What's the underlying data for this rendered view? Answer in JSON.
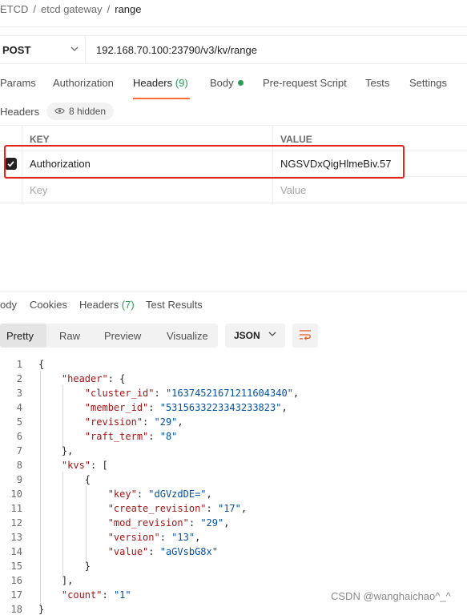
{
  "breadcrumb": {
    "items": [
      "ETCD",
      "etcd gateway",
      "range"
    ],
    "sep": "/"
  },
  "request": {
    "method": "POST",
    "url": "192.168.70.100:23790/v3/kv/range"
  },
  "req_tabs": [
    {
      "label": "Params"
    },
    {
      "label": "Authorization"
    },
    {
      "label": "Headers",
      "count": "(9)"
    },
    {
      "label": "Body"
    },
    {
      "label": "Pre-request Script"
    },
    {
      "label": "Tests"
    },
    {
      "label": "Settings"
    }
  ],
  "headers_section": {
    "label": "Headers",
    "hidden": "8 hidden"
  },
  "table": {
    "col_key": "KEY",
    "col_value": "VALUE",
    "rows": [
      {
        "key": "Authorization",
        "value": "NGSVDxQigHlmeBiv.57",
        "checked": true
      }
    ],
    "placeholder_key": "Key",
    "placeholder_value": "Value"
  },
  "response": {
    "tabs": [
      {
        "label": "ody"
      },
      {
        "label": "Cookies"
      },
      {
        "label": "Headers",
        "count": "(7)"
      },
      {
        "label": "Test Results"
      }
    ],
    "formats": [
      "Pretty",
      "Raw",
      "Preview",
      "Visualize"
    ],
    "language": "JSON",
    "code": [
      {
        "n": "1",
        "t": "{"
      },
      {
        "n": "2",
        "t": "    \"header\": {"
      },
      {
        "n": "3",
        "t": "        \"cluster_id\": \"16374521671211604340\","
      },
      {
        "n": "4",
        "t": "        \"member_id\": \"5315633223343233823\","
      },
      {
        "n": "5",
        "t": "        \"revision\": \"29\","
      },
      {
        "n": "6",
        "t": "        \"raft_term\": \"8\""
      },
      {
        "n": "7",
        "t": "    },"
      },
      {
        "n": "8",
        "t": "    \"kvs\": ["
      },
      {
        "n": "9",
        "t": "        {"
      },
      {
        "n": "10",
        "t": "            \"key\": \"dGVzdDE=\","
      },
      {
        "n": "11",
        "t": "            \"create_revision\": \"17\","
      },
      {
        "n": "12",
        "t": "            \"mod_revision\": \"29\","
      },
      {
        "n": "13",
        "t": "            \"version\": \"13\","
      },
      {
        "n": "14",
        "t": "            \"value\": \"aGVsbG8x\""
      },
      {
        "n": "15",
        "t": "        }"
      },
      {
        "n": "16",
        "t": "    ],"
      },
      {
        "n": "17",
        "t": "    \"count\": \"1\""
      },
      {
        "n": "18",
        "t": "}"
      }
    ]
  },
  "watermark": "CSDN @wanghaichao^_^",
  "colors": {
    "accent": "#ff6c37",
    "green": "#2a9d57",
    "highlight": "#e5231f"
  }
}
